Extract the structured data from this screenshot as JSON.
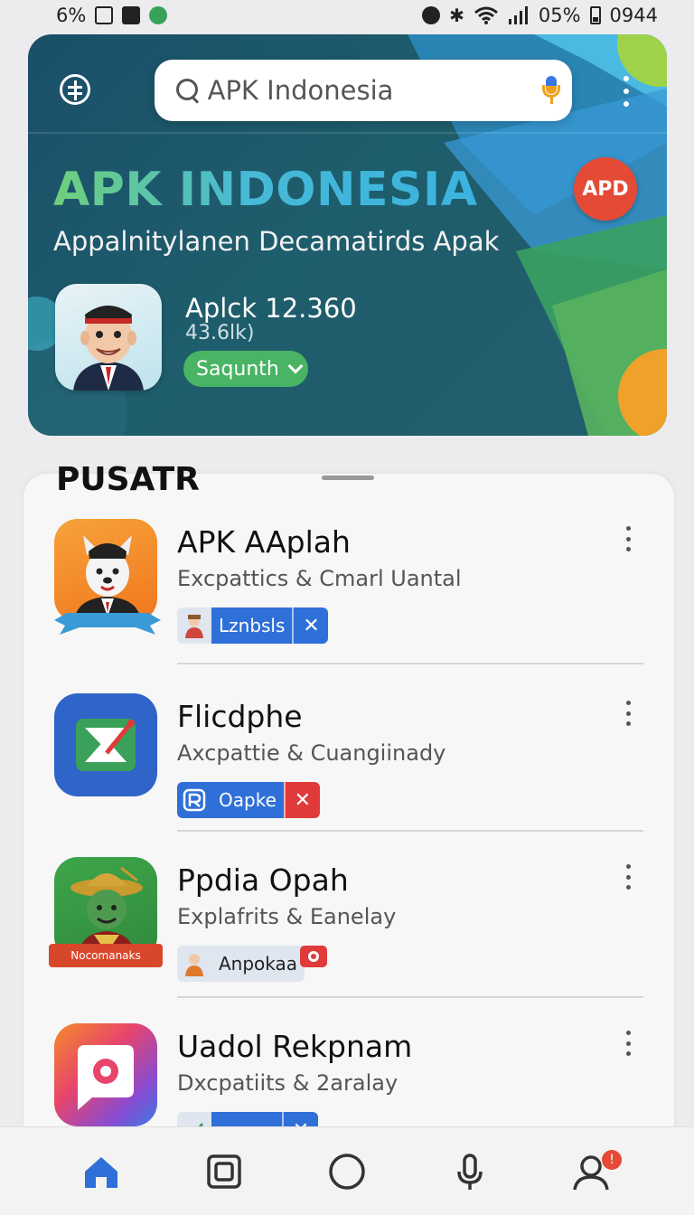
{
  "status_bar": {
    "left_text": "6%",
    "battery_text": "05%",
    "time": "0944"
  },
  "hero": {
    "search_placeholder": "APK Indonesia",
    "title": "APK INDONESIA",
    "subtitle": "Appalnitylanen Decamatirds Apak",
    "badge": "APD",
    "featured": {
      "name": "Aplck 12.360",
      "size": "43.6lk)",
      "button_label": "Saqunth"
    },
    "colors": {
      "accent_green": "#49b463",
      "badge_red": "#e54a36"
    }
  },
  "section": {
    "title": "PUSATR"
  },
  "apps": [
    {
      "name": "APK AAplah",
      "desc": "Excpattics & Cmarl Uantal",
      "tag": "Lznbsls",
      "tag_icon": "person-icon",
      "tag_color": "#2f6fd8",
      "action_color": "#2f6fd8",
      "icon": "mascot-app-icon"
    },
    {
      "name": "Flicdphe",
      "desc": "Axcpattie & Cuangiinady",
      "tag": "Oapke",
      "tag_icon": "r-logo-icon",
      "tag_color": "#2f6fd8",
      "action_color": "#e03a3a",
      "icon": "envelope-app-icon"
    },
    {
      "name": "Ppdia Opah",
      "desc": "Explafrits & Eanelay",
      "tag": "Anpokaa",
      "tag_icon": "person-icon",
      "tag_color": "#dfe6f0",
      "action_color": "#e03a3a",
      "icon": "farmer-app-icon",
      "ribbon": "Nocomanaks"
    },
    {
      "name": "Uadol Rekpnam",
      "desc": "Dxcpatiits & 2aralay",
      "tag": "",
      "tag_icon": "check-icon",
      "tag_color": "#2f6fd8",
      "action_color": "#2f6fd8",
      "icon": "gradient-app-icon"
    }
  ],
  "bottom_nav": {
    "items": [
      "home-icon",
      "apps-icon",
      "circle-icon",
      "mic-icon",
      "profile-icon"
    ],
    "active_color": "#2f6fd8"
  }
}
